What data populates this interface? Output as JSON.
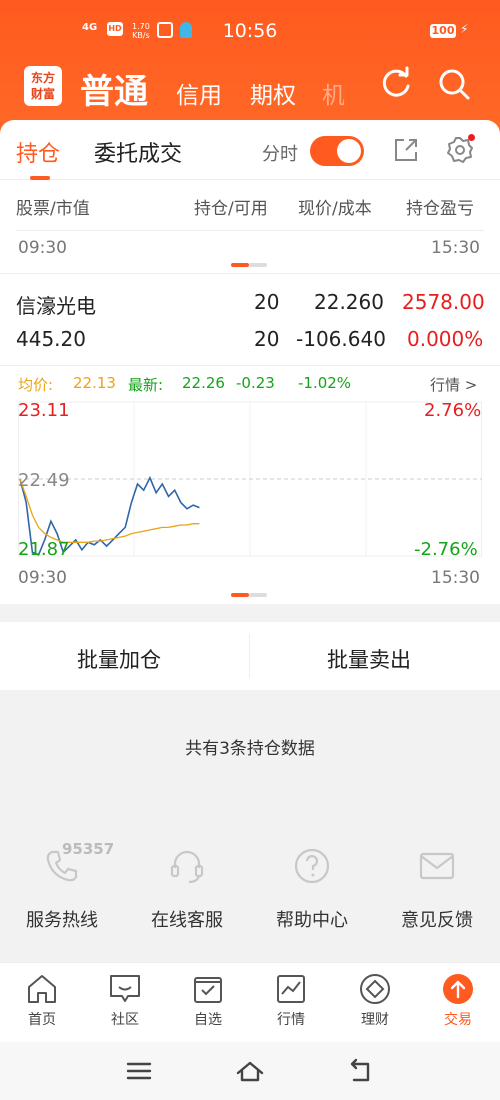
{
  "status": {
    "network": "4G",
    "hd": "HD",
    "speed_value": "1.70",
    "speed_unit": "KB/s",
    "time": "10:56",
    "battery": "100"
  },
  "header": {
    "logo_top": "东方",
    "logo_bottom": "财富",
    "tabs": [
      "普通",
      "信用",
      "期权",
      "机"
    ]
  },
  "subtabs": {
    "position": "持仓",
    "entrust": "委托成交",
    "fenshi_label": "分时",
    "fenshi_on": true
  },
  "table": {
    "headers": [
      "股票/市值",
      "持仓/可用",
      "现价/成本",
      "持仓盈亏"
    ],
    "time_start": "09:30",
    "time_end": "15:30",
    "row": {
      "name": "信濠光电",
      "market_value": "445.20",
      "position": "20",
      "available": "20",
      "price": "22.260",
      "cost": "-106.640",
      "pnl": "2578.00",
      "pnl_pct": "0.000%"
    }
  },
  "quote": {
    "avg_label": "均价:",
    "avg_value": "22.13",
    "latest_label": "最新:",
    "latest_value": "22.26",
    "change": "-0.23",
    "change_pct": "-1.02%",
    "link": "行情 >"
  },
  "chart_labels": {
    "high": "23.11",
    "mid": "22.49",
    "low": "21.87",
    "high_pct": "2.76%",
    "low_pct": "-2.76%",
    "t_start": "09:30",
    "t_end": "15:30"
  },
  "chart_data": {
    "type": "line",
    "ylim": [
      21.87,
      23.11
    ],
    "reference": 22.49,
    "series": [
      {
        "values": [
          22.49,
          22.3,
          21.9,
          21.88,
          22.0,
          22.15,
          22.05,
          21.9,
          21.95,
          22.0,
          21.92,
          21.98,
          21.96,
          22.0,
          21.95,
          22.0,
          22.05,
          22.1,
          22.3,
          22.45,
          22.4,
          22.5,
          22.38,
          22.45,
          22.35,
          22.4,
          22.3,
          22.25,
          22.28,
          22.26
        ]
      },
      {
        "values": [
          22.49,
          22.35,
          22.2,
          22.1,
          22.05,
          22.02,
          22.0,
          21.98,
          21.98,
          21.98,
          21.98,
          21.98,
          21.99,
          21.99,
          22.0,
          22.01,
          22.02,
          22.03,
          22.05,
          22.06,
          22.07,
          22.08,
          22.09,
          22.1,
          22.1,
          22.11,
          22.12,
          22.12,
          22.13,
          22.13
        ]
      }
    ]
  },
  "actions": {
    "add": "批量加仓",
    "sell": "批量卖出"
  },
  "summary": "共有3条持仓数据",
  "services": {
    "hotline_number": "95357",
    "items": [
      "服务热线",
      "在线客服",
      "帮助中心",
      "意见反馈"
    ]
  },
  "bottom_nav": [
    "首页",
    "社区",
    "自选",
    "行情",
    "理财",
    "交易"
  ],
  "colors": {
    "accent": "#ff5a1f",
    "up": "#e62020",
    "down": "#16a31a",
    "avg": "#e9a51a",
    "price_line": "#2e67a8"
  }
}
